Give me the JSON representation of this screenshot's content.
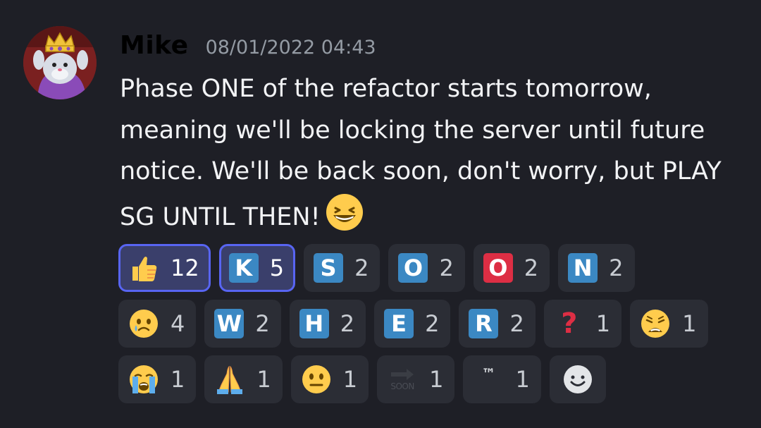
{
  "message": {
    "author": "Mike",
    "timestamp": "08/01/2022 04:43",
    "text": "Phase ONE of the refactor starts tomorrow, meaning we'll be locking the server until future notice. We'll be back soon, don't worry, but PLAY SG UNTIL THEN!",
    "trailing_emoji": "grinning-squinting-face"
  },
  "reactions": {
    "row1": [
      {
        "emoji": "thumbs-up",
        "count": "12",
        "selected": true
      },
      {
        "emoji": "regional-indicator",
        "letter": "K",
        "count": "5",
        "selected": true
      },
      {
        "emoji": "regional-indicator",
        "letter": "S",
        "count": "2",
        "selected": false
      },
      {
        "emoji": "regional-indicator",
        "letter": "O",
        "count": "2",
        "selected": false
      },
      {
        "emoji": "o-button-blood-type",
        "letter": "O",
        "count": "2",
        "selected": false
      },
      {
        "emoji": "regional-indicator",
        "letter": "N",
        "count": "2",
        "selected": false
      }
    ],
    "row2": [
      {
        "emoji": "face-holding-back-tears",
        "count": "4"
      },
      {
        "emoji": "regional-indicator",
        "letter": "W",
        "count": "2"
      },
      {
        "emoji": "regional-indicator",
        "letter": "H",
        "count": "2"
      },
      {
        "emoji": "regional-indicator",
        "letter": "E",
        "count": "2"
      },
      {
        "emoji": "regional-indicator",
        "letter": "R",
        "count": "2"
      },
      {
        "emoji": "red-question-mark",
        "label": "?",
        "count": "1"
      },
      {
        "emoji": "weary-face",
        "count": "1"
      }
    ],
    "row3": [
      {
        "emoji": "loudly-crying-face",
        "count": "1"
      },
      {
        "emoji": "folded-hands",
        "count": "1"
      },
      {
        "emoji": "neutral-face",
        "count": "1"
      },
      {
        "emoji": "soon-arrow",
        "label": "SOON",
        "count": "1"
      },
      {
        "emoji": "trade-mark",
        "label": "™",
        "count": "1"
      }
    ],
    "add_reaction_icon": "add-reaction-smiley-icon"
  },
  "colors": {
    "background": "#1e1f26",
    "pill": "#2b2d35",
    "pill_selected": "#3a3f6b",
    "pill_selected_border": "#5865f2",
    "regional_indicator": "#3b88c3",
    "blood_type_o": "#dd2e44",
    "emoji_yellow": "#ffcc4d"
  }
}
